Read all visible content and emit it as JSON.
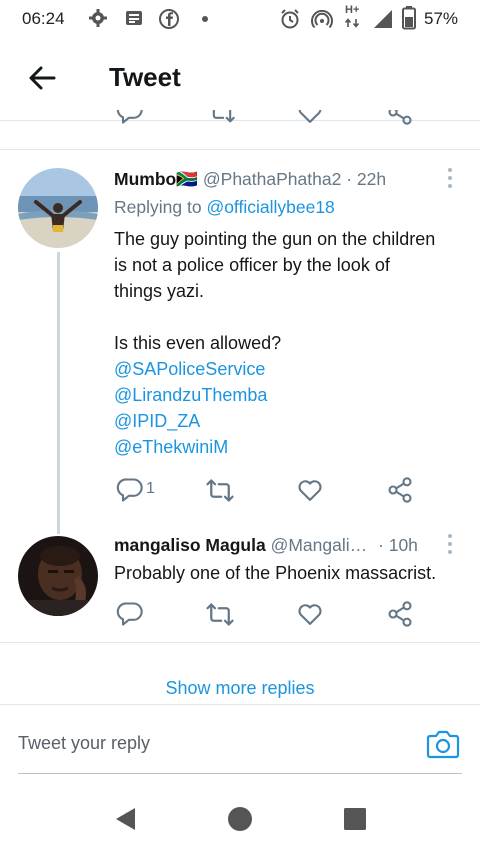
{
  "status_bar": {
    "time": "06:24",
    "battery": "57%",
    "network": "H+"
  },
  "app_bar": {
    "title": "Tweet"
  },
  "tweets": [
    {
      "display_name": "Mumbo",
      "flag": "🇿🇦",
      "handle": "@PhathaPhatha2",
      "sep": "·",
      "time": "22h",
      "replying_prefix": "Replying to",
      "replying_to": "@officiallybee18",
      "text_lines": [
        "The guy pointing the gun on the children",
        "is not a police officer by the look of",
        "things yazi."
      ],
      "question": "Is this even allowed?",
      "mentions": [
        "@SAPoliceService",
        "@LirandzuThemba",
        "@IPID_ZA",
        "@eThekwiniM"
      ],
      "reply_count": "1"
    },
    {
      "display_name": "mangaliso Magula",
      "handle": "@Mangali…",
      "sep": "·",
      "time": "10h",
      "text": "Probably one of the Phoenix massacrist."
    }
  ],
  "show_more_replies": "Show more replies",
  "reply_composer": {
    "placeholder": "Tweet your reply"
  },
  "colors": {
    "link": "#1b95e0",
    "muted": "#657786",
    "text": "#14171a",
    "divider": "#e1e8ed"
  },
  "icons": [
    "settings-icon",
    "news-icon",
    "facebook-icon",
    "alarm-icon",
    "hotspot-icon",
    "signal-icon",
    "battery-icon",
    "back-arrow-icon",
    "reply-icon",
    "retweet-icon",
    "like-icon",
    "share-icon",
    "camera-icon",
    "nav-back-icon",
    "nav-home-icon",
    "nav-recents-icon"
  ]
}
